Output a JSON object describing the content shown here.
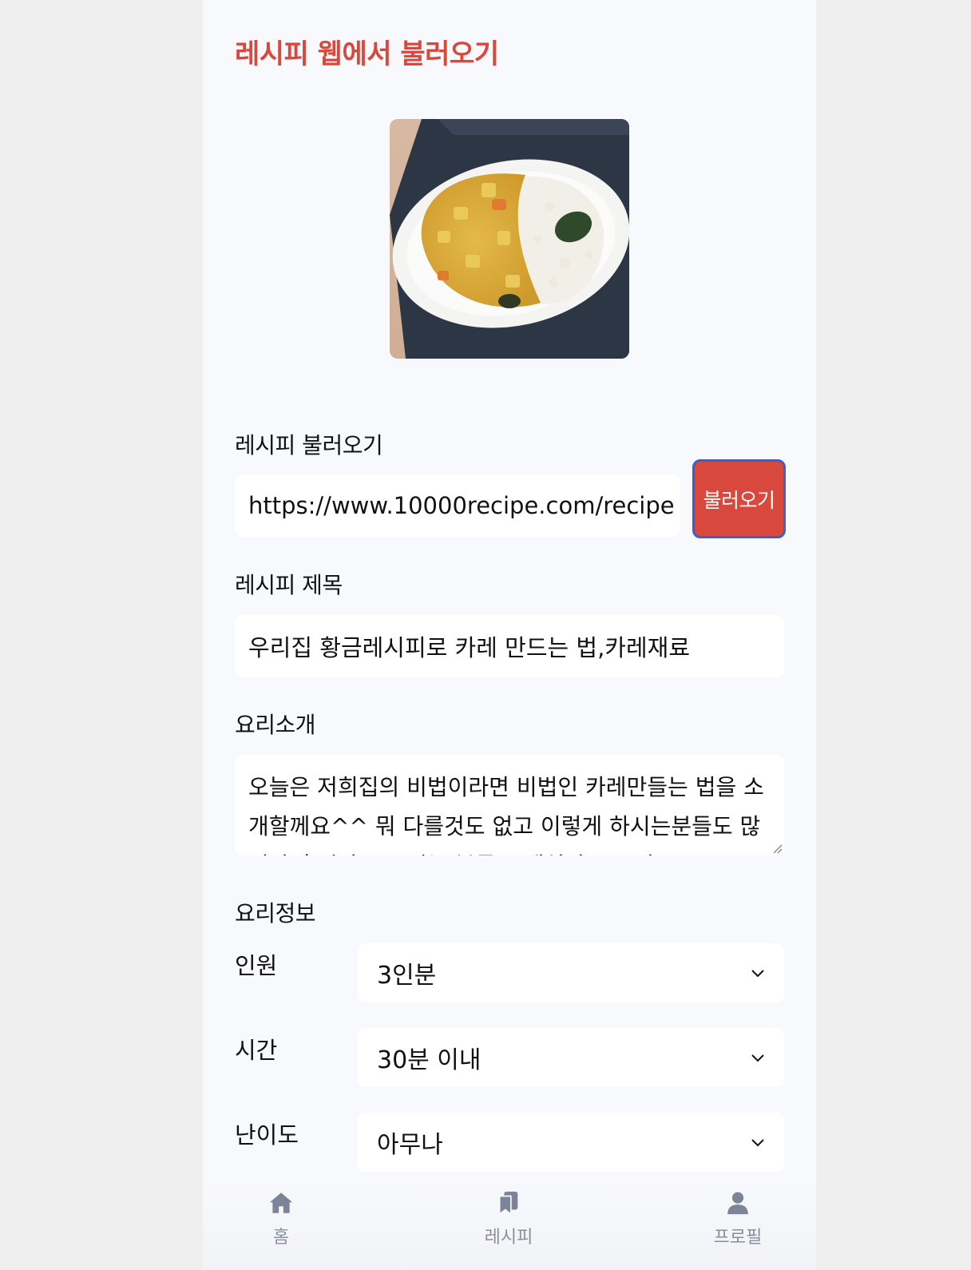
{
  "header": {
    "title": "레시피 웹에서 불러오기"
  },
  "thumbnail": {
    "alt": "curry-rice-photo"
  },
  "import": {
    "label": "레시피 불러오기",
    "url_value": "https://www.10000recipe.com/recipe",
    "button_label": "불러오기"
  },
  "recipe_title": {
    "label": "레시피 제목",
    "value": "우리집 황금레시피로 카레 만드는 법,카레재료"
  },
  "intro": {
    "label": "요리소개",
    "value": "오늘은 저희집의 비법이라면 비법인 카레만들는 법을 소개할께요^^ 뭐 다를것도 없고 이렇게 하시는분들도 많지만 혹시나 모르시는 분들도 계실까 모르니 소"
  },
  "info": {
    "label": "요리정보",
    "servings": {
      "label": "인원",
      "value": "3인분"
    },
    "time": {
      "label": "시간",
      "value": "30분 이내"
    },
    "difficulty": {
      "label": "난이도",
      "value": "아무나"
    }
  },
  "tabbar": {
    "home": {
      "label": "홈",
      "icon": "home-icon"
    },
    "recipes": {
      "label": "레시피",
      "icon": "bookmark-icon"
    },
    "profile": {
      "label": "프로필",
      "icon": "user-icon"
    }
  },
  "colors": {
    "accent": "#d9483c",
    "focus_border": "#3a5fcf",
    "tab_inactive": "#8a8fa0",
    "background": "#f8f9fd"
  }
}
